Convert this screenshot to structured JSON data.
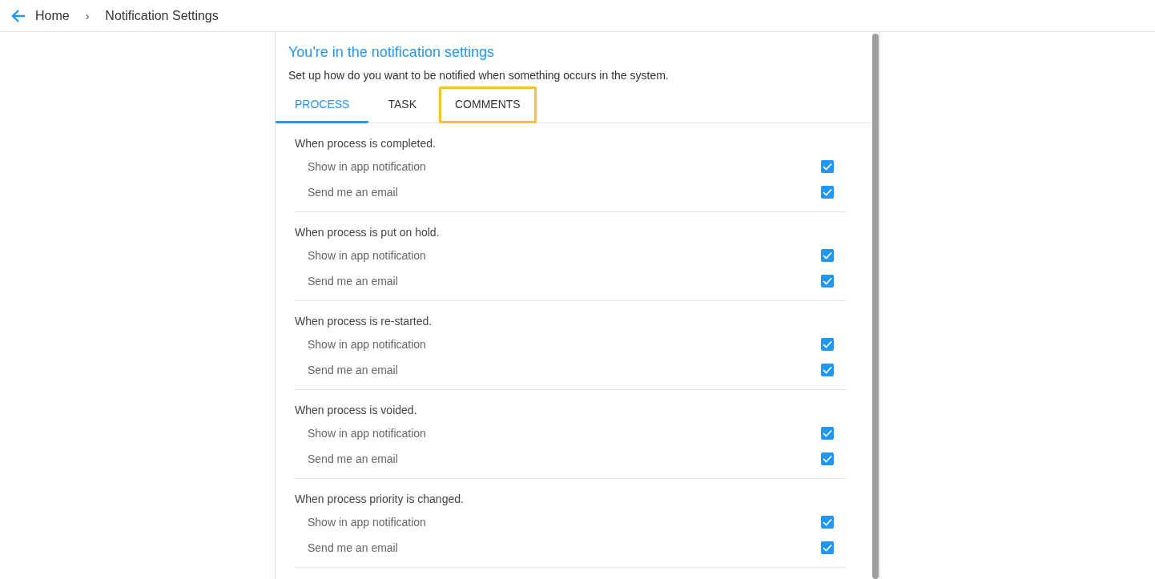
{
  "breadcrumb": {
    "items": [
      "Home",
      "Notification Settings"
    ],
    "separator": "›"
  },
  "panel": {
    "title": "You're in the notification settings",
    "subtitle": "Set up how do you want to be notified when something occurs in the system.",
    "tabs": [
      {
        "label": "PROCESS",
        "selected": true,
        "highlighted": false
      },
      {
        "label": "TASK",
        "selected": false,
        "highlighted": false
      },
      {
        "label": "COMMENTS",
        "selected": false,
        "highlighted": true
      }
    ],
    "sections": [
      {
        "heading": "When process is completed.",
        "options": [
          {
            "label": "Show in app notification",
            "checked": true
          },
          {
            "label": "Send me an email",
            "checked": true
          }
        ]
      },
      {
        "heading": "When process is put on hold.",
        "options": [
          {
            "label": "Show in app notification",
            "checked": true
          },
          {
            "label": "Send me an email",
            "checked": true
          }
        ]
      },
      {
        "heading": "When process is re-started.",
        "options": [
          {
            "label": "Show in app notification",
            "checked": true
          },
          {
            "label": "Send me an email",
            "checked": true
          }
        ]
      },
      {
        "heading": "When process is voided.",
        "options": [
          {
            "label": "Show in app notification",
            "checked": true
          },
          {
            "label": "Send me an email",
            "checked": true
          }
        ]
      },
      {
        "heading": "When process priority is changed.",
        "options": [
          {
            "label": "Show in app notification",
            "checked": true
          },
          {
            "label": "Send me an email",
            "checked": true
          }
        ]
      }
    ]
  }
}
